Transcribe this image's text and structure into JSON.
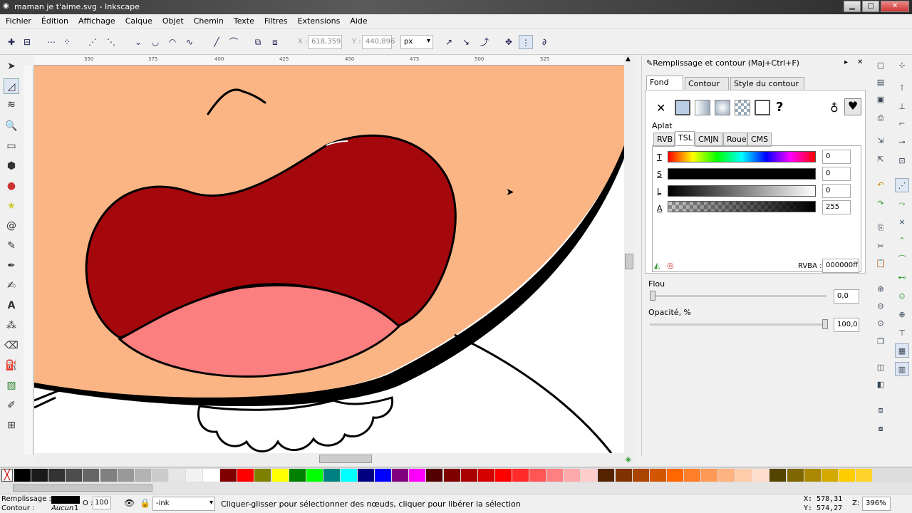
{
  "window": {
    "title": "maman je t'aime.svg - Inkscape"
  },
  "menu": [
    "Fichier",
    "Édition",
    "Affichage",
    "Calque",
    "Objet",
    "Chemin",
    "Texte",
    "Filtres",
    "Extensions",
    "Aide"
  ],
  "toolbar": {
    "x_label": "X :",
    "x_value": "618,359",
    "y_label": "Y :",
    "y_value": "440,896",
    "unit": "px"
  },
  "ruler": {
    "ticks": [
      "350",
      "375",
      "400",
      "425",
      "450",
      "475",
      "500",
      "525"
    ]
  },
  "panel": {
    "title": "Remplissage et contour (Maj+Ctrl+F)",
    "tabs": [
      "Fond",
      "Contour",
      "Style du contour"
    ],
    "fill_mode": "Aplat",
    "color_tabs": [
      "RVB",
      "TSL",
      "CMJN",
      "Roue",
      "CMS"
    ],
    "sliders": [
      {
        "label": "T",
        "value": "0"
      },
      {
        "label": "S",
        "value": "0"
      },
      {
        "label": "L",
        "value": "0"
      },
      {
        "label": "A",
        "value": "255"
      }
    ],
    "rgba_label": "RVBA :",
    "rgba_value": "000000ff",
    "blur_label": "Flou",
    "blur_value": "0,0",
    "opacity_label": "Opacité, %",
    "opacity_value": "100,0"
  },
  "status": {
    "fill_label": "Remplissage :",
    "stroke_label": "Contour :",
    "stroke_value": "Aucun",
    "stroke_width": "1",
    "opacity_label": "O :",
    "opacity_value": "100",
    "layer": "-ink",
    "message": "Cliquer-glisser pour sélectionner des nœuds, cliquer pour libérer la sélection",
    "x": "X:  578,31",
    "y": "Y:  574,27",
    "zoom_label": "Z:",
    "zoom": "396%"
  },
  "colors": {
    "skin": "#fbb584",
    "mouth": "#a4070c",
    "tongue": "#fb7f7f"
  }
}
